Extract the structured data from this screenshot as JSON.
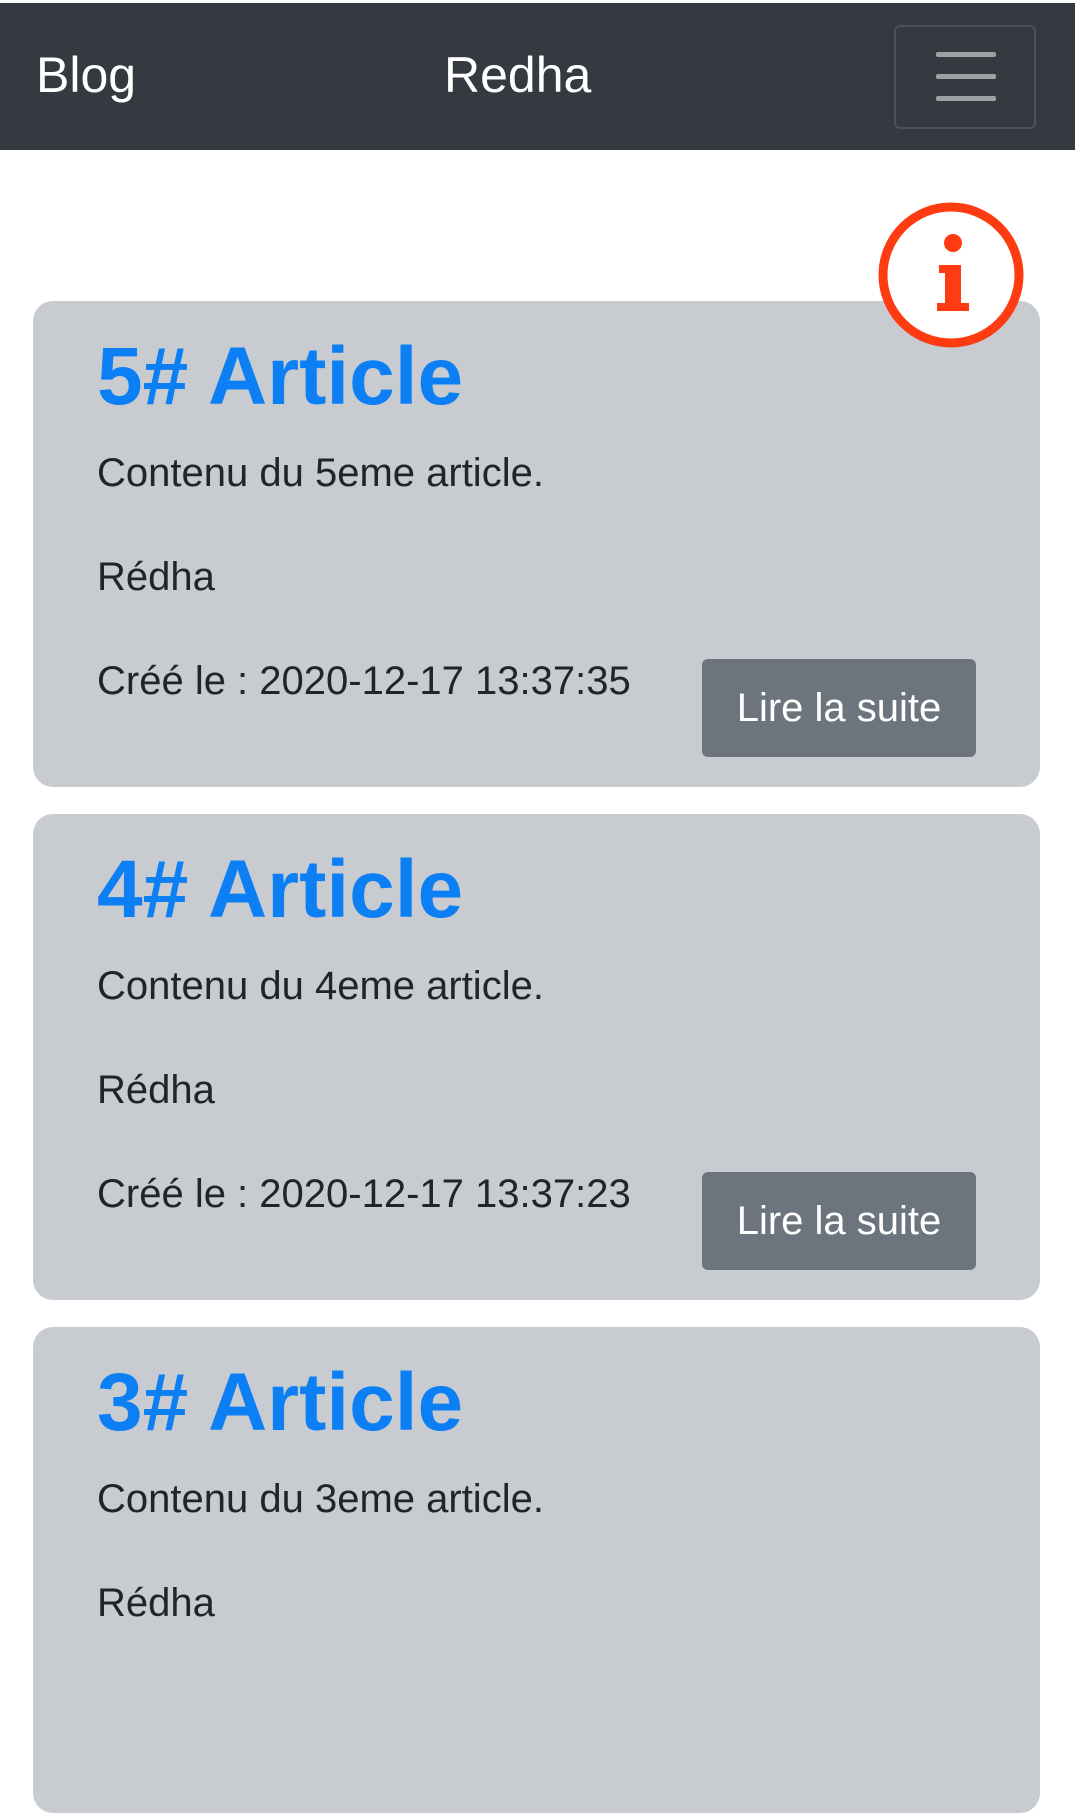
{
  "navbar": {
    "brand": "Blog",
    "user": "Redha",
    "toggler_icon": "hamburger-menu-icon",
    "background": "#343a40"
  },
  "info_icon": {
    "icon": "info-circle-icon",
    "color": "#ff3b12"
  },
  "articles": [
    {
      "title": "5# Article",
      "content": "Contenu du 5eme article.",
      "author": "Rédha",
      "created": "Créé le : 2020-12-17 13:37:35",
      "button_label": "Lire la suite"
    },
    {
      "title": "4# Article",
      "content": "Contenu du 4eme article.",
      "author": "Rédha",
      "created": "Créé le : 2020-12-17 13:37:23",
      "button_label": "Lire la suite"
    },
    {
      "title": "3# Article",
      "content": "Contenu du 3eme article.",
      "author": "Rédha"
    }
  ],
  "colors": {
    "card_background": "#c8ccd0",
    "title_link": "#0d7ff5",
    "button_background": "#6c757d",
    "text": "#212529"
  }
}
